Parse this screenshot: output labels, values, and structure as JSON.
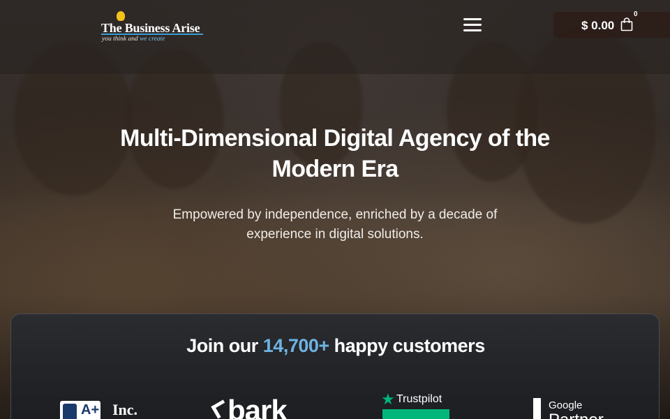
{
  "header": {
    "logo": {
      "title": "The Business Arise",
      "tagline_start": "you think and ",
      "tagline_accent": "we create"
    },
    "menu_icon": "hamburger-menu-icon",
    "cart": {
      "amount": "$ 0.00",
      "count": "0",
      "icon": "shopping-bag-icon"
    }
  },
  "hero": {
    "headline": "Multi-Dimensional Digital Agency of the Modern Era",
    "subline": "Empowered by independence, enriched by a decade of experience in digital solutions."
  },
  "customers": {
    "title_before": "Join our ",
    "title_highlight": "14,700+",
    "title_after": " happy customers",
    "badges": {
      "bbb_rating": "A+",
      "inc": "Inc.",
      "bark": "bark",
      "trustpilot": "Trustpilot",
      "google_line1": "Google",
      "google_line2": "Partner"
    }
  },
  "colors": {
    "accent_blue": "#6fb3e3",
    "trustpilot_green": "#00b67a",
    "logo_yellow": "#f2c21a"
  }
}
